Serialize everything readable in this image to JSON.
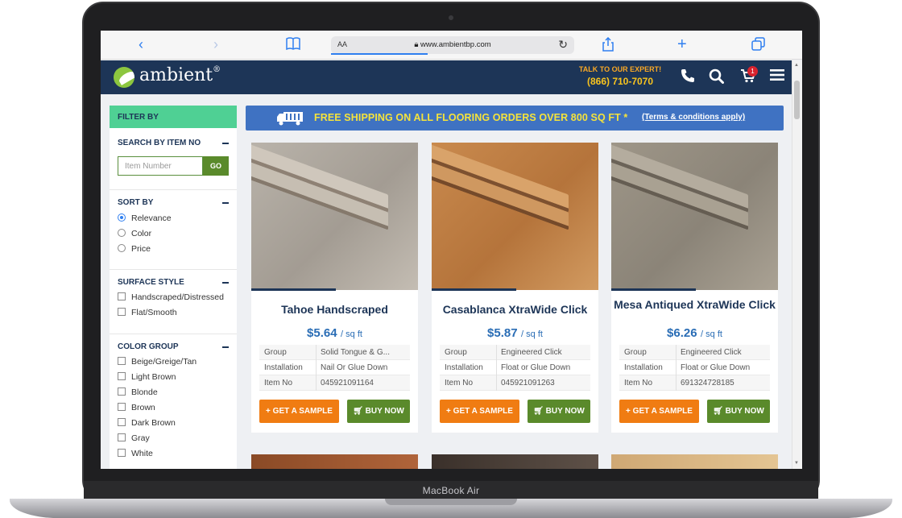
{
  "device": {
    "label": "MacBook Air"
  },
  "browser": {
    "address_prefix": "AA",
    "url": "www.ambientbp.com",
    "icons": [
      "back-icon",
      "forward-icon",
      "bookmarks-icon",
      "reload-icon",
      "share-icon",
      "new-tab-icon",
      "tabs-icon"
    ]
  },
  "header": {
    "logo_text": "ambient",
    "logo_reg": "®",
    "talk_label": "TALK TO OUR EXPERT!",
    "phone": "(866) 710-7070",
    "cart_count": "1",
    "colors": {
      "bar": "#1d3557",
      "accent": "#f9c41e",
      "badge": "#d9232e"
    }
  },
  "sidebar": {
    "filter_title": "FILTER BY",
    "search": {
      "title": "SEARCH BY ITEM NO",
      "placeholder": "Item Number",
      "go_label": "GO"
    },
    "sort": {
      "title": "SORT BY",
      "options": [
        "Relevance",
        "Color",
        "Price"
      ],
      "selected": "Relevance"
    },
    "surface": {
      "title": "SURFACE STYLE",
      "options": [
        "Handscraped/Distressed",
        "Flat/Smooth"
      ]
    },
    "color_group": {
      "title": "COLOR GROUP",
      "options": [
        "Beige/Greige/Tan",
        "Light Brown",
        "Blonde",
        "Brown",
        "Dark Brown",
        "Gray",
        "White"
      ]
    }
  },
  "banner": {
    "text": "FREE SHIPPING ON ALL FLOORING ORDERS OVER 800 SQ FT *",
    "link": "(Terms & conditions apply)",
    "color": "#3f72c2",
    "text_color": "#f5e33b"
  },
  "products": [
    {
      "title": "Tahoe Handscraped",
      "price": "$5.64",
      "unit": "/ sq ft",
      "specs": [
        {
          "label": "Group",
          "value": "Solid Tongue & G..."
        },
        {
          "label": "Installation",
          "value": "Nail Or Glue Down"
        },
        {
          "label": "Item No",
          "value": "045921091164"
        }
      ],
      "sample_label": "+ GET A SAMPLE",
      "buy_label": "BUY NOW"
    },
    {
      "title": "Casablanca XtraWide Click",
      "price": "$5.87",
      "unit": "/ sq ft",
      "specs": [
        {
          "label": "Group",
          "value": "Engineered Click"
        },
        {
          "label": "Installation",
          "value": "Float or Glue Down"
        },
        {
          "label": "Item No",
          "value": "045921091263"
        }
      ],
      "sample_label": "+ GET A SAMPLE",
      "buy_label": "BUY NOW"
    },
    {
      "title": "Mesa Antiqued XtraWide Click",
      "price": "$6.26",
      "unit": "/ sq ft",
      "specs": [
        {
          "label": "Group",
          "value": "Engineered Click"
        },
        {
          "label": "Installation",
          "value": "Float or Glue Down"
        },
        {
          "label": "Item No",
          "value": "691324728185"
        }
      ],
      "sample_label": "+ GET A SAMPLE",
      "buy_label": "BUY NOW"
    }
  ],
  "button_colors": {
    "sample": "#f07c12",
    "buy": "#5a8a2b"
  }
}
